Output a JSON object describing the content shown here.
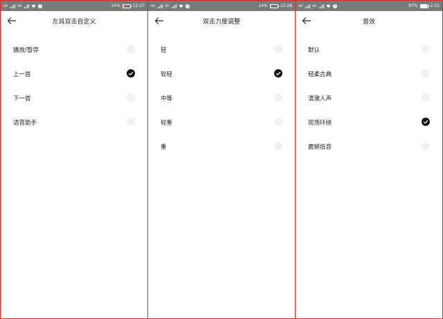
{
  "screens": [
    {
      "status": {
        "battery": "14%",
        "time": "12:27",
        "battery_level": 0.14,
        "battery_low": true
      },
      "title": "左耳双击自定义",
      "options": [
        {
          "label": "播放/暂停",
          "selected": false
        },
        {
          "label": "上一首",
          "selected": true
        },
        {
          "label": "下一首",
          "selected": false
        },
        {
          "label": "语音助手",
          "selected": false
        }
      ]
    },
    {
      "status": {
        "battery": "14%",
        "time": "12:28",
        "battery_level": 0.14,
        "battery_low": true
      },
      "title": "双击力度调整",
      "options": [
        {
          "label": "轻",
          "selected": false
        },
        {
          "label": "较轻",
          "selected": true
        },
        {
          "label": "中等",
          "selected": false
        },
        {
          "label": "较重",
          "selected": false
        },
        {
          "label": "重",
          "selected": false
        }
      ]
    },
    {
      "status": {
        "battery": "97%",
        "time": "2:31",
        "battery_level": 0.97,
        "battery_low": false
      },
      "title": "音效",
      "options": [
        {
          "label": "默认",
          "selected": false
        },
        {
          "label": "轻柔古典",
          "selected": false
        },
        {
          "label": "清澈人声",
          "selected": false
        },
        {
          "label": "现场环绕",
          "selected": true
        },
        {
          "label": "震撼低音",
          "selected": false
        }
      ]
    }
  ],
  "colors": {
    "frame_border": "#d42a2a",
    "statusbar": "#7a7a7a",
    "check_selected": "#111111",
    "check_unselected": "#f1f1f1",
    "text": "#222222"
  }
}
